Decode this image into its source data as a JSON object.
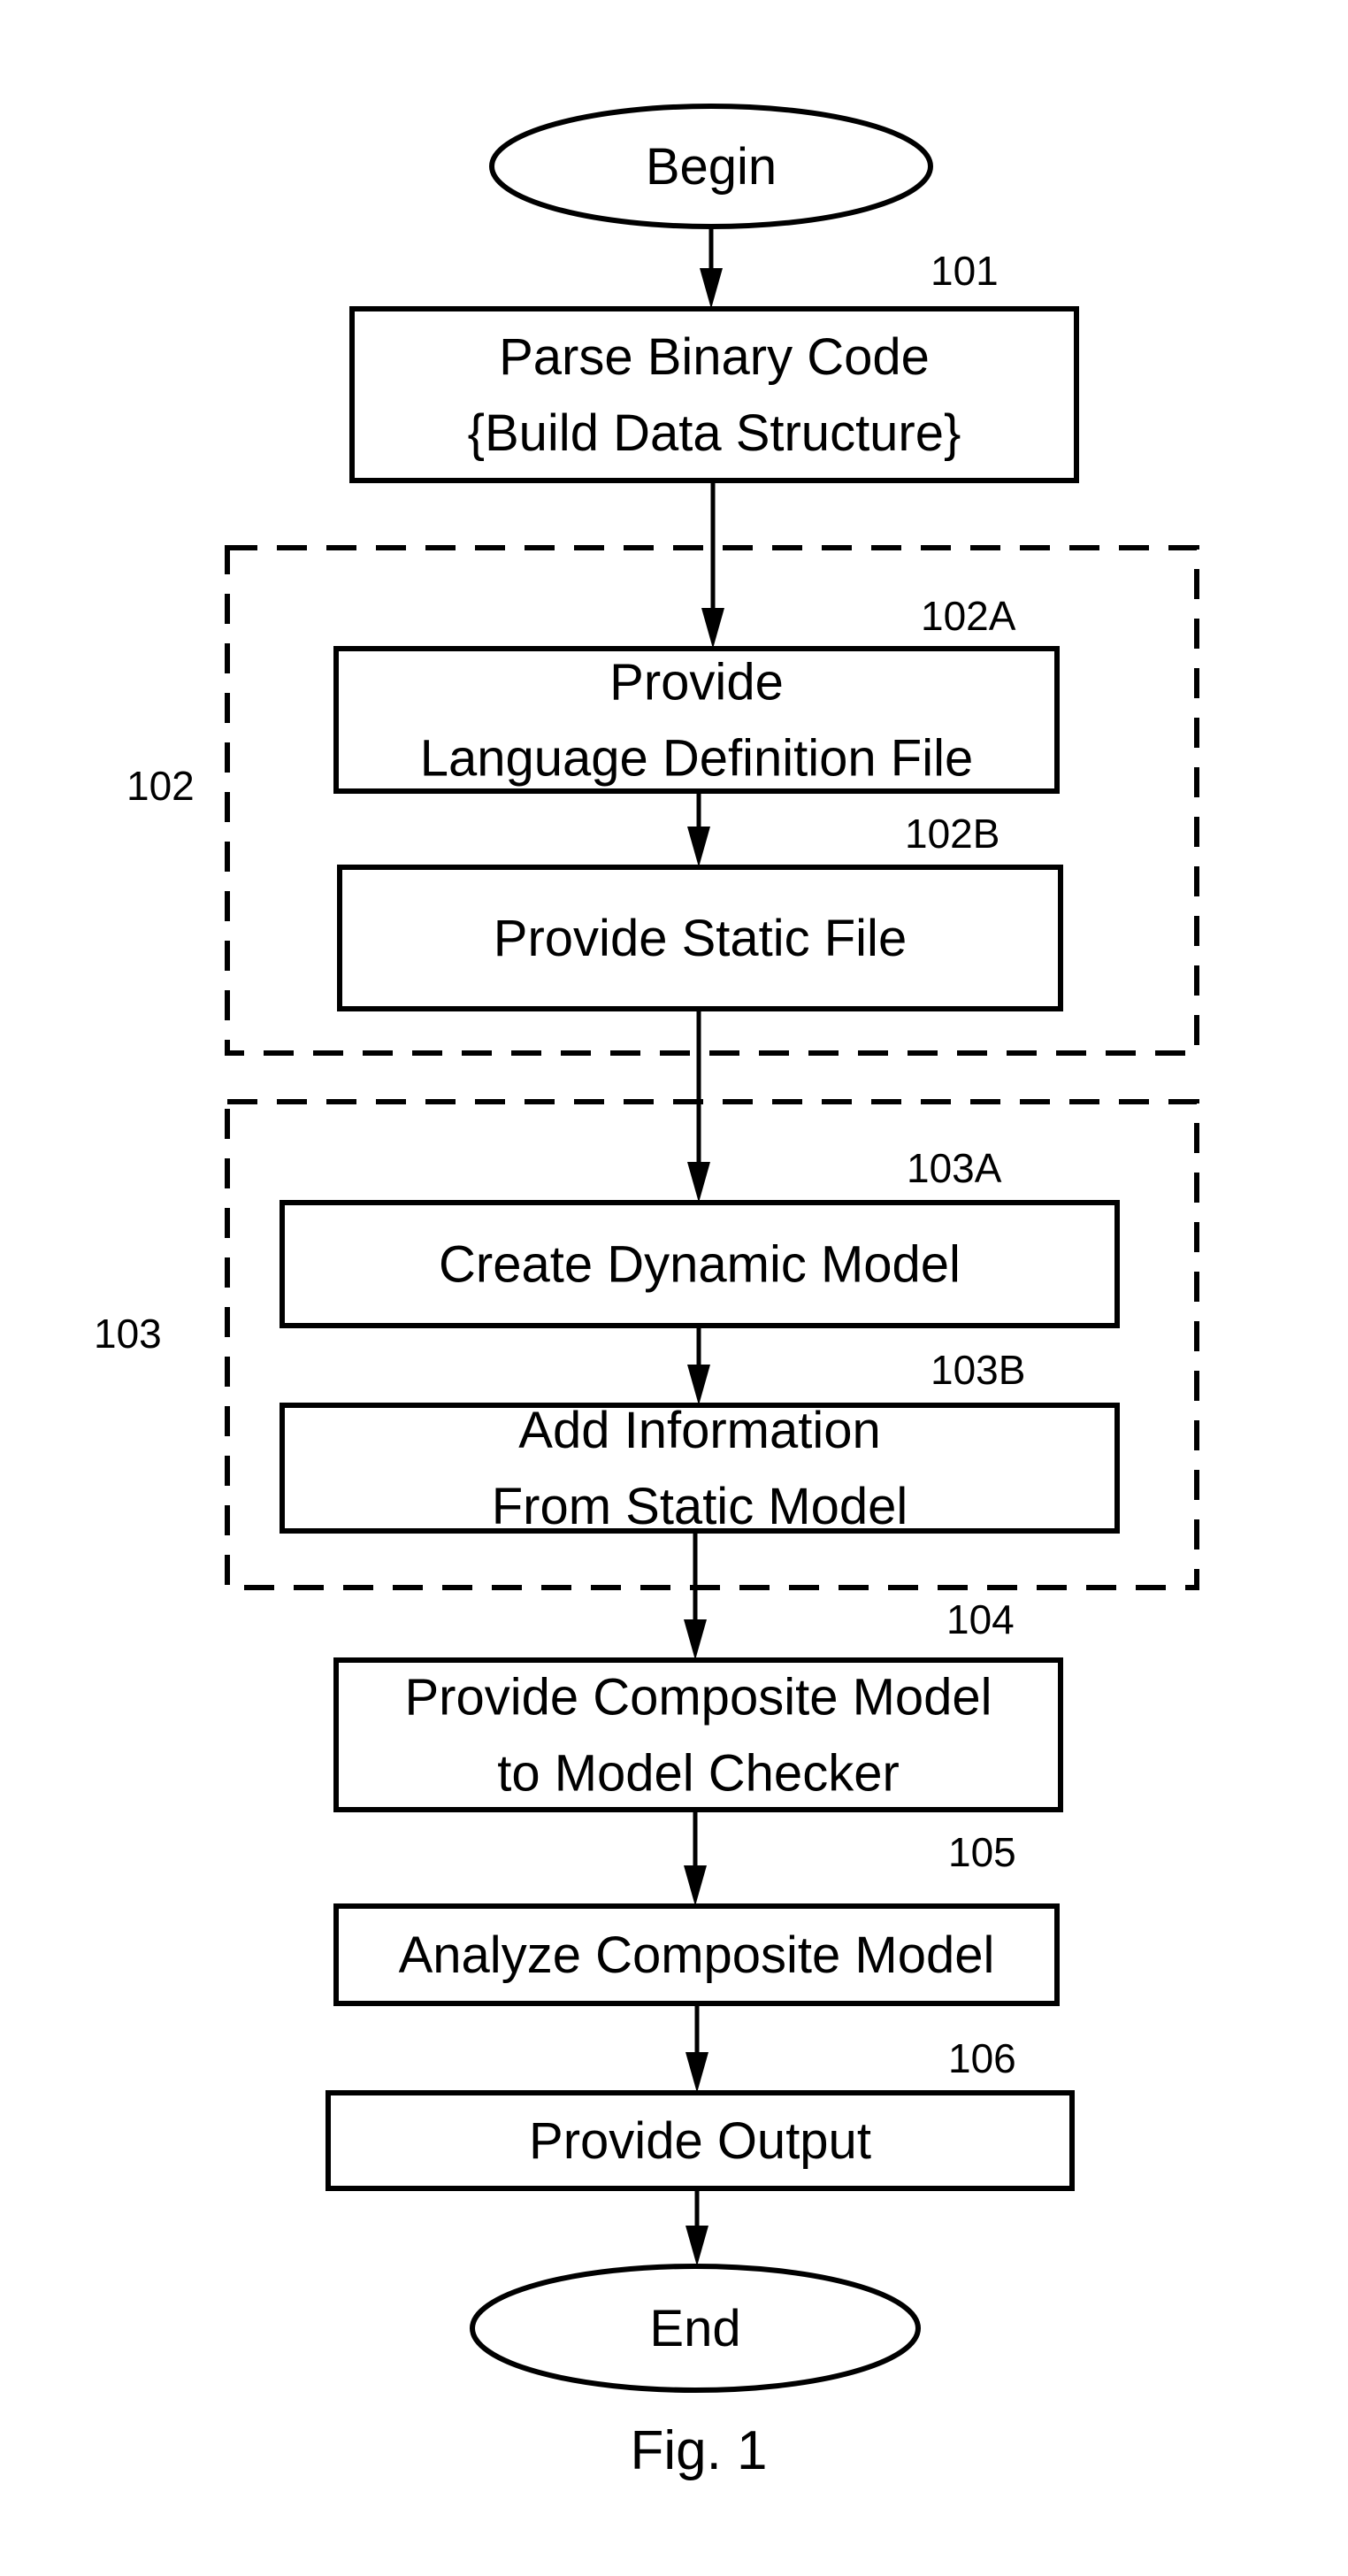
{
  "figure": {
    "caption": "Fig. 1",
    "nodes": [
      {
        "id": "begin",
        "shape": "terminal",
        "ref": "",
        "lines": [
          "Begin"
        ]
      },
      {
        "id": "101",
        "shape": "process",
        "ref": "101",
        "lines": [
          "Parse Binary Code",
          "{Build Data Structure}"
        ]
      },
      {
        "id": "102A",
        "shape": "process",
        "ref": "102A",
        "group": "102",
        "lines": [
          "Provide",
          "Language Definition File"
        ]
      },
      {
        "id": "102B",
        "shape": "process",
        "ref": "102B",
        "group": "102",
        "lines": [
          "Provide Static File"
        ]
      },
      {
        "id": "103A",
        "shape": "process",
        "ref": "103A",
        "group": "103",
        "lines": [
          "Create Dynamic Model"
        ]
      },
      {
        "id": "103B",
        "shape": "process",
        "ref": "103B",
        "group": "103",
        "lines": [
          "Add Information",
          "From Static Model"
        ]
      },
      {
        "id": "104",
        "shape": "process",
        "ref": "104",
        "lines": [
          "Provide Composite Model",
          "to Model Checker"
        ]
      },
      {
        "id": "105",
        "shape": "process",
        "ref": "105",
        "lines": [
          "Analyze Composite Model"
        ]
      },
      {
        "id": "106",
        "shape": "process",
        "ref": "106",
        "lines": [
          "Provide Output"
        ]
      },
      {
        "id": "end",
        "shape": "terminal",
        "ref": "",
        "lines": [
          "End"
        ]
      }
    ],
    "groups": [
      {
        "id": "102",
        "ref": "102",
        "style": "dashed"
      },
      {
        "id": "103",
        "ref": "103",
        "style": "dashed"
      }
    ],
    "edges": [
      [
        "begin",
        "101"
      ],
      [
        "101",
        "102A"
      ],
      [
        "102A",
        "102B"
      ],
      [
        "102B",
        "103A"
      ],
      [
        "103A",
        "103B"
      ],
      [
        "103B",
        "104"
      ],
      [
        "104",
        "105"
      ],
      [
        "105",
        "106"
      ],
      [
        "106",
        "end"
      ]
    ]
  }
}
